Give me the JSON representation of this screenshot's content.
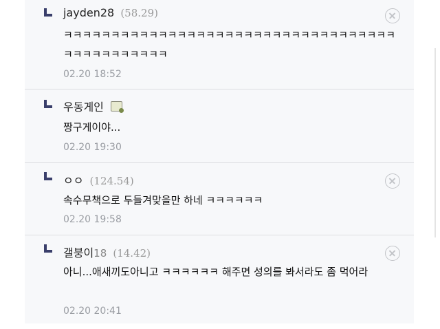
{
  "comments": [
    {
      "author": "jayden28",
      "author_suffix": "",
      "ip": "(58.29)",
      "body": "ㅋㅋㅋㅋㅋㅋㅋㅋㅋㅋㅋㅋㅋㅋㅋㅋㅋㅋㅋㅋㅋㅋㅋㅋㅋㅋㅋㅋㅋㅋㅋㅋㅋㅋㅋㅋㅋㅋㅋㅋㅋㅋㅋㅋㅋㅋ",
      "time": "02.20 18:52",
      "has_delete": true
    },
    {
      "author": "우동게인",
      "author_suffix": "",
      "ip": "",
      "body": "짱구게이야...",
      "time": "02.20 19:30",
      "has_delete": false
    },
    {
      "author": "ㅇㅇ",
      "author_suffix": "",
      "ip": "(124.54)",
      "body": "속수무책으로 두들겨맞을만 하네 ㅋㅋㅋㅋㅋㅋ",
      "time": "02.20 19:58",
      "has_delete": true
    },
    {
      "author": "갤붕이",
      "author_suffix": "18",
      "ip": "(14.42)",
      "body": "아니...애새끼도아니고 ㅋㅋㅋㅋㅋㅋ 해주면 성의를 봐서라도 좀 먹어라",
      "time": "02.20 20:41",
      "has_delete": true
    }
  ]
}
